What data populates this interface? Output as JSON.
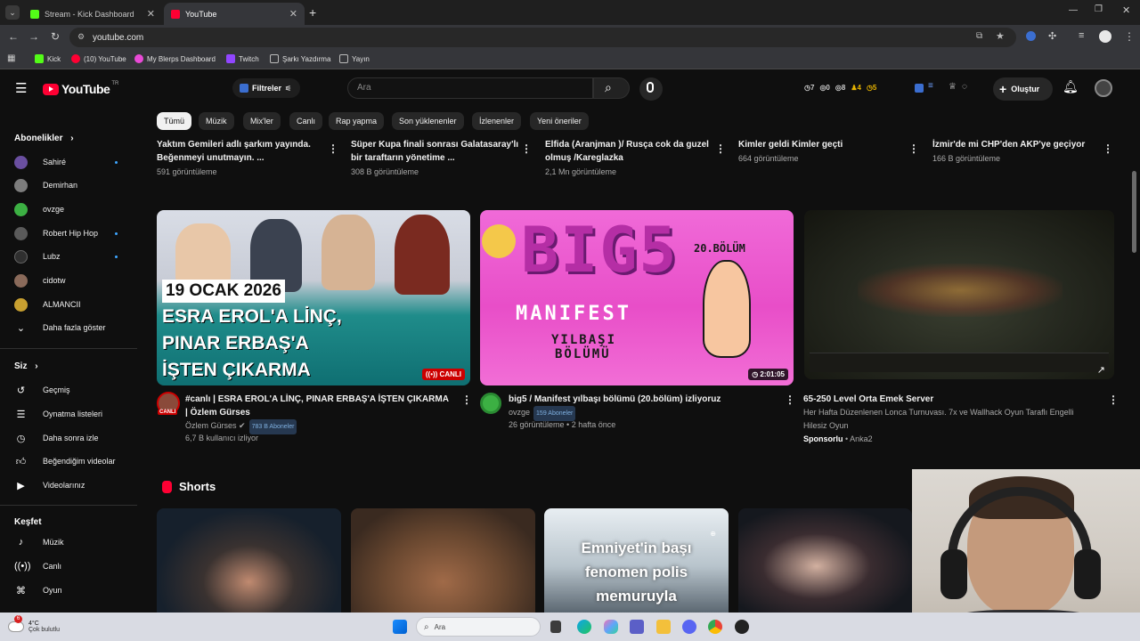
{
  "browser": {
    "tabs": [
      {
        "title": "Stream - Kick Dashboard",
        "color": "#53fc18",
        "active": false
      },
      {
        "title": "YouTube",
        "color": "#ff0033",
        "active": true
      }
    ],
    "new_tab_icon": "plus",
    "url": "youtube.com",
    "bookmarks": [
      {
        "label": "Kick",
        "color": "#53fc18"
      },
      {
        "label": "(10) YouTube",
        "color": "#ff0033"
      },
      {
        "label": "My Blerps Dashboard",
        "color": "#e94ad6"
      },
      {
        "label": "Twitch",
        "color": "#9146ff"
      },
      {
        "label": "Şarkı Yazdırma",
        "color": "#888888"
      },
      {
        "label": "Yayın",
        "color": "#888888"
      }
    ]
  },
  "header": {
    "logo_text": "YouTube",
    "country": "TR",
    "filters_label": "Filtreler",
    "search_placeholder": "Ara",
    "stats": [
      {
        "icon": "clock-icon",
        "value": "7",
        "color": "#cccccc"
      },
      {
        "icon": "eye-icon",
        "value": "0",
        "color": "#cccccc"
      },
      {
        "icon": "eye-icon",
        "value": "8",
        "color": "#cccccc"
      },
      {
        "icon": "person-icon",
        "value": "4",
        "color": "#e8b400"
      },
      {
        "icon": "clock-icon",
        "value": "5",
        "color": "#e8b400"
      }
    ],
    "create_label": "Oluştur"
  },
  "sidebar": {
    "subscriptions_title": "Abonelikler",
    "channels": [
      {
        "name": "Sahiré",
        "color": "#6a4fa0",
        "new": true
      },
      {
        "name": "Demirhan",
        "color": "#7d7d7d",
        "new": false
      },
      {
        "name": "ovzge",
        "color": "#3cb043",
        "new": false
      },
      {
        "name": "Robert Hip Hop",
        "color": "#5a5a5a",
        "new": true
      },
      {
        "name": "Lubz",
        "color": "#2f2f2f",
        "new": true
      },
      {
        "name": "cidotw",
        "color": "#8a6a5a",
        "new": false
      },
      {
        "name": "ALMANCII",
        "color": "#c8a030",
        "new": false
      }
    ],
    "show_more": "Daha fazla göster",
    "you_title": "Siz",
    "you_items": [
      {
        "label": "Geçmiş",
        "icon": "history-icon"
      },
      {
        "label": "Oynatma listeleri",
        "icon": "playlist-icon"
      },
      {
        "label": "Daha sonra izle",
        "icon": "clock-icon"
      },
      {
        "label": "Beğendiğim videolar",
        "icon": "thumbs-up-icon"
      },
      {
        "label": "Videolarınız",
        "icon": "video-icon"
      }
    ],
    "explore_title": "Keşfet",
    "explore_items": [
      {
        "label": "Müzik",
        "icon": "music-icon"
      },
      {
        "label": "Canlı",
        "icon": "live-icon"
      },
      {
        "label": "Oyun",
        "icon": "game-icon"
      }
    ]
  },
  "chips": [
    "Tümü",
    "Müzik",
    "Mix'ler",
    "Canlı",
    "Rap yapma",
    "Son yüklenenler",
    "İzlenenler",
    "Yeni öneriler"
  ],
  "top_row": [
    {
      "title": "Yaktım Gemileri adlı şarkım yayında. Beğenmeyi unutmayın. ...",
      "meta": "591 görüntüleme"
    },
    {
      "title": "Süper Kupa finali sonrası Galatasaray'lı bir taraftarın yönetime ...",
      "meta": "308 B görüntüleme"
    },
    {
      "title": "Elfida (Aranjman )/ Rusça cok da guzel olmuş /Kareglazka",
      "meta": "2,1 Mn görüntüleme"
    },
    {
      "title": "Kimler geldi Kimler geçti",
      "meta": "664 görüntüleme"
    },
    {
      "title": "İzmir'de mi CHP'den AKP'ye geçiyor",
      "meta": "166 B görüntüleme"
    }
  ],
  "videos": [
    {
      "thumb_lines": [
        "19 OCAK 2026",
        "ESRA EROL'A LİNÇ,",
        "PINAR ERBAŞ'A",
        "İŞTEN ÇIKARMA"
      ],
      "badge": "CANLI",
      "avatar_badge": "CANLI",
      "title": "#canlı | ESRA EROL'A LİNÇ, PINAR ERBAŞ'A İŞTEN ÇIKARMA | Özlem Gürses",
      "channel": "Özlem Gürses",
      "subs": "783 B Aboneler",
      "meta": "6,7 B kullanıcı izliyor"
    },
    {
      "thumb_lines": [
        "BIG5",
        "20.BÖLÜM",
        "MANIFEST",
        "YILBAŞI",
        "BÖLÜMÜ"
      ],
      "badge": "2:01:05",
      "title": "big5 / Manifest  yılbaşı bölümü (20.bölüm) izliyoruz",
      "channel": "ovzge",
      "subs": "159 Aboneler",
      "meta": "26 görüntüleme • 2 hafta önce"
    },
    {
      "title": "65-250 Level Orta Emek Server",
      "desc": "Her Hafta Düzenlenen Lonca Turnuvası. 7x ve Wallhack Oyun Taraflı Engelli Hilesiz Oyun",
      "sponsored": "Sponsorlu",
      "channel": "Anka2"
    }
  ],
  "shorts": {
    "title": "Shorts",
    "items": [
      {
        "color": "#1d2a3a"
      },
      {
        "color": "#5a4030"
      },
      {
        "color": "#7a8fa0",
        "caption": [
          "Emniyet'in başı",
          "fenomen polis",
          "memuruyla"
        ]
      },
      {
        "color": "#20242c"
      }
    ]
  },
  "taskbar": {
    "weather_temp": "4°C",
    "weather_desc": "Çok bulutlu",
    "weather_badge": "6",
    "search": "Ara"
  }
}
